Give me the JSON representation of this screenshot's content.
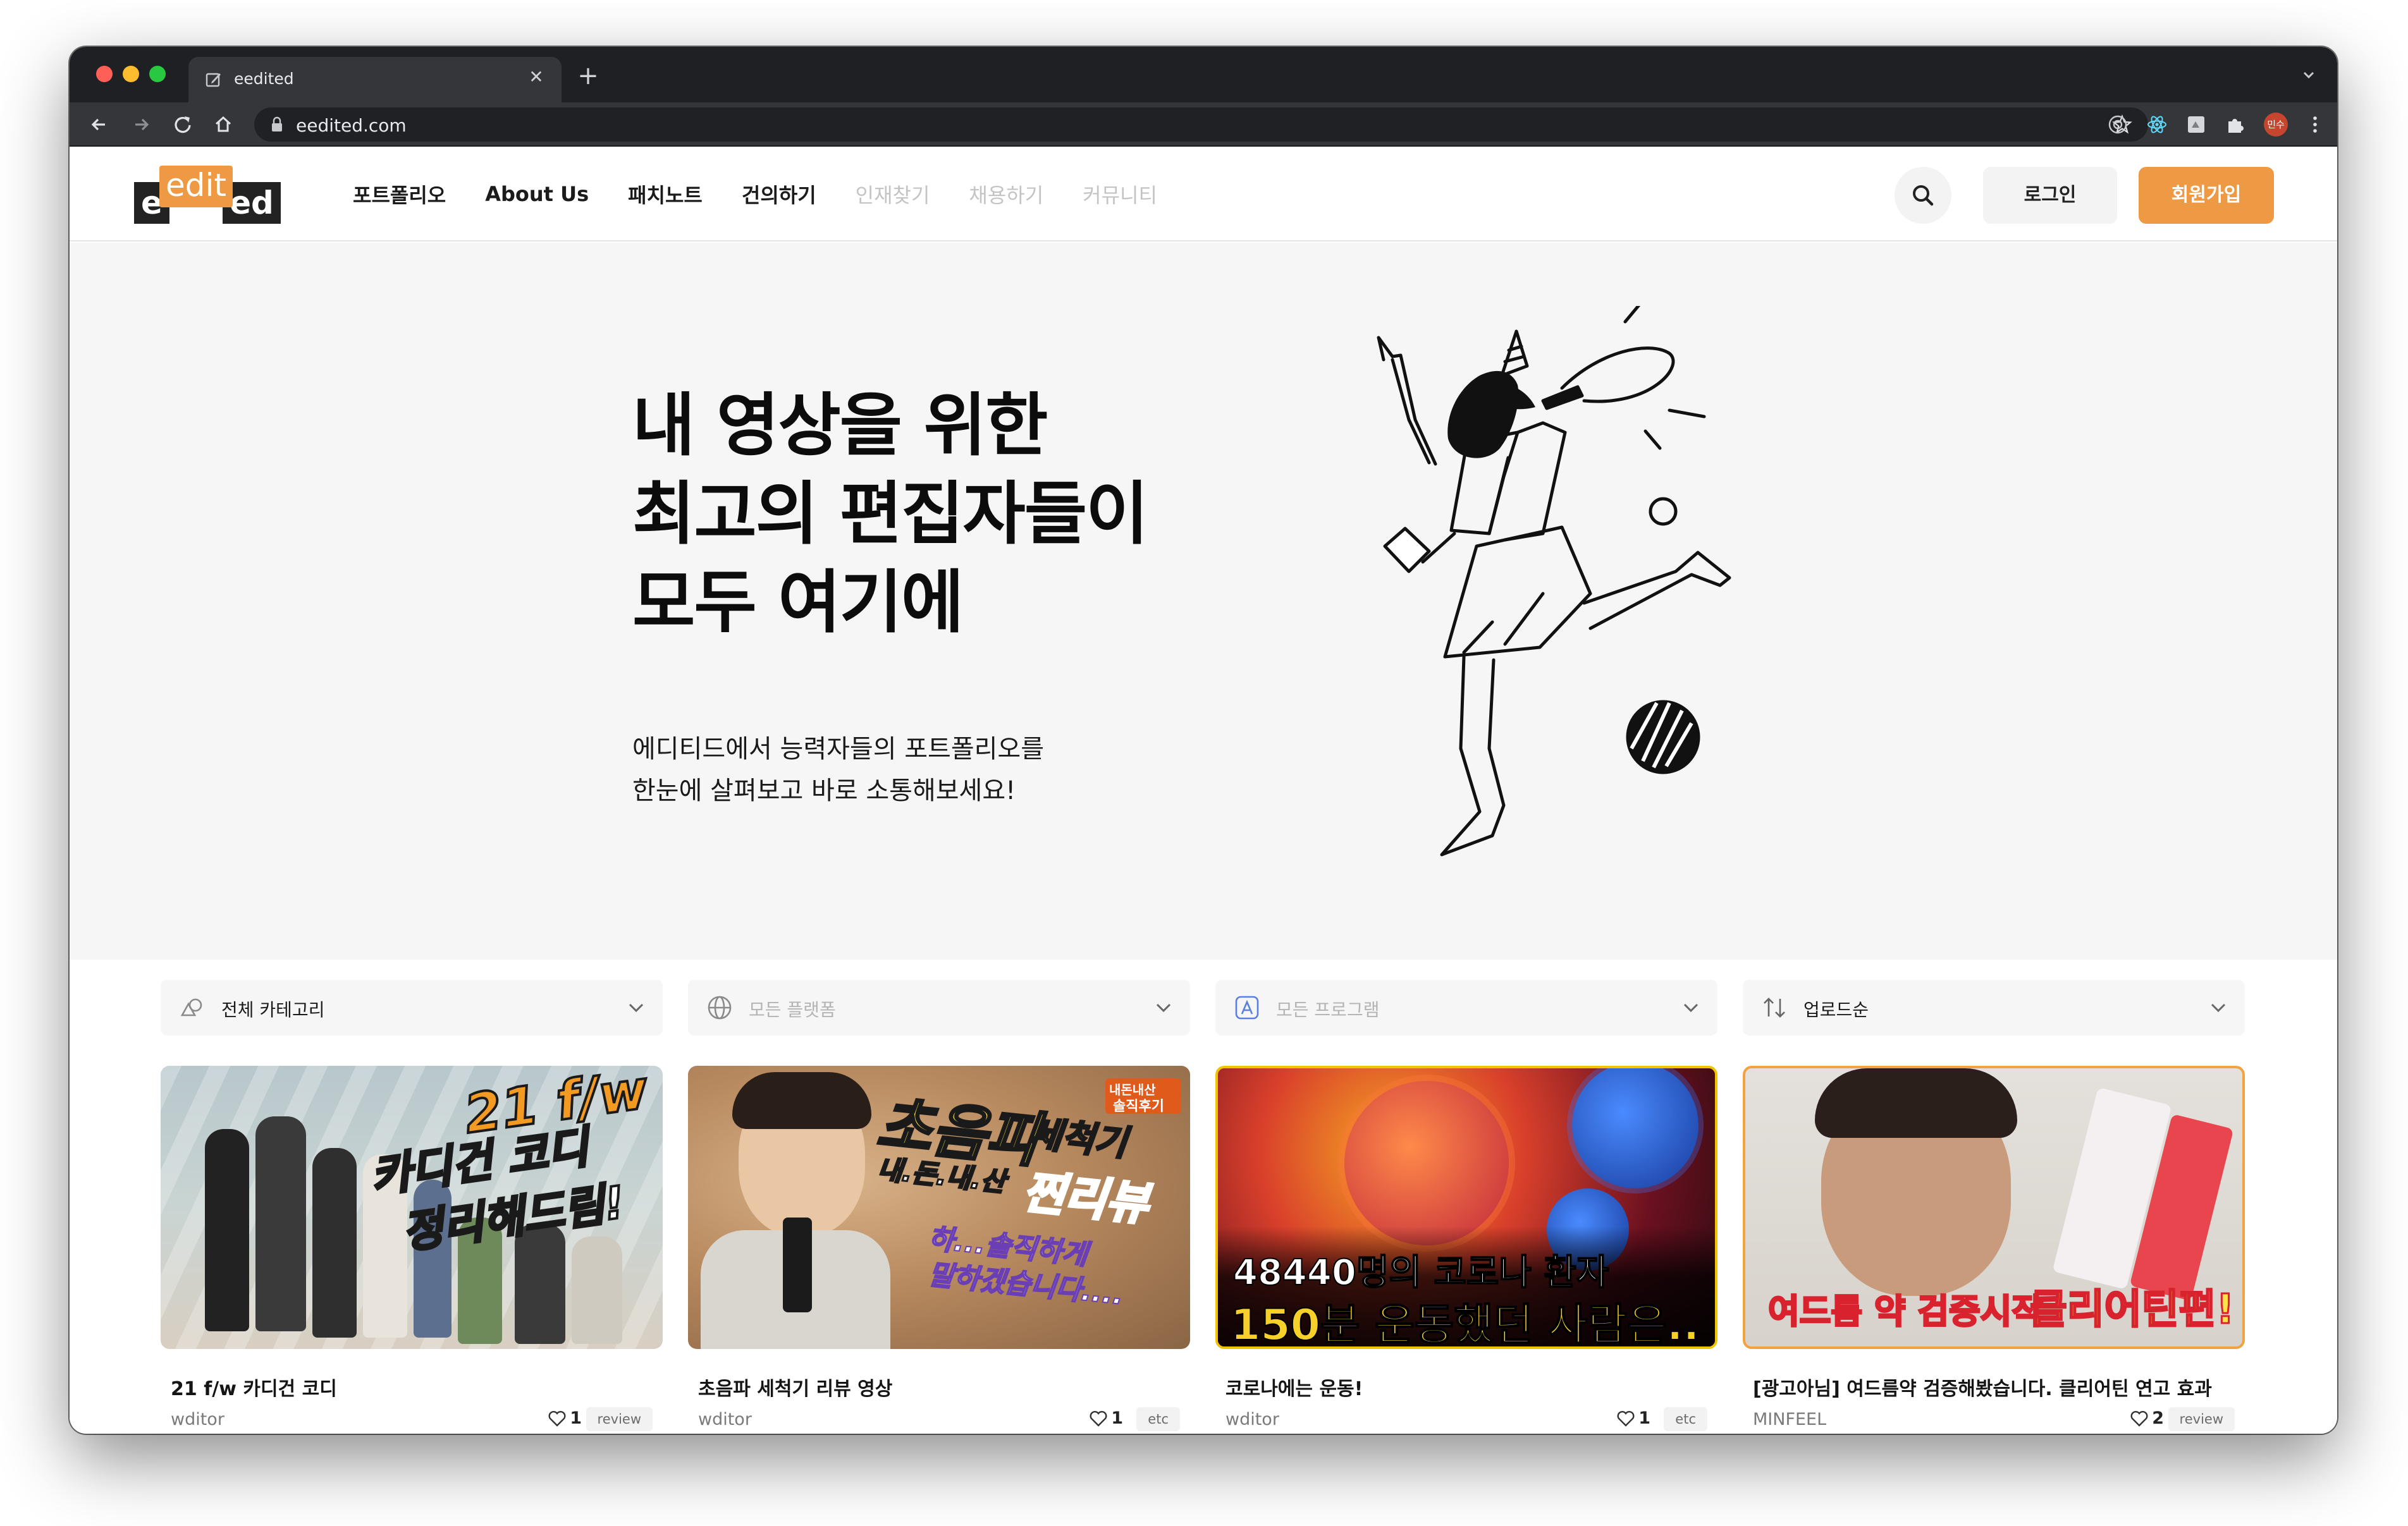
{
  "browser": {
    "tab_title": "eedited",
    "url": "eedited.com",
    "profile_initials": "민수"
  },
  "header": {
    "logo": {
      "left": "e",
      "middle": "edit",
      "right": "ed"
    },
    "nav": [
      "포트폴리오",
      "About Us",
      "패치노트",
      "건의하기",
      "인재찾기",
      "채용하기",
      "커뮤니티"
    ],
    "login_label": "로그인",
    "signup_label": "회원가입"
  },
  "hero": {
    "title_lines": [
      "내 영상을 위한",
      "최고의 편집자들이",
      "모두 여기에"
    ],
    "subtitle_lines": [
      "에디티드에서 능력자들의 포트폴리오를",
      "한눈에 살펴보고 바로 소통해보세요!"
    ]
  },
  "filters": [
    {
      "icon": "shapes-icon",
      "label": "전체 카테고리",
      "muted": false
    },
    {
      "icon": "globe-icon",
      "label": "모든 플랫폼",
      "muted": true
    },
    {
      "icon": "app-icon",
      "label": "모든 프로그램",
      "muted": true
    },
    {
      "icon": "sort-icon",
      "label": "업로드순",
      "muted": false
    }
  ],
  "cards": [
    {
      "title": "21 f/w 카디건 코디",
      "author": "wditor",
      "likes": "1",
      "tag": "review",
      "thumb_text": [
        "21 f/w",
        "카디건 코디",
        "정리해드림!"
      ]
    },
    {
      "title": "초음파 세척기 리뷰 영상",
      "author": "wditor",
      "likes": "1",
      "tag": "etc",
      "thumb_text": [
        "초음파",
        "세척기",
        "내.돈.내.산",
        "찐리뷰",
        "하...솔직하게",
        "말하겠습니다....",
        "내돈내산",
        "솔직후기"
      ]
    },
    {
      "title": "코로나에는 운동!",
      "author": "wditor",
      "likes": "1",
      "tag": "etc",
      "thumb_text": [
        "48440명의 코로나 환자",
        "150분 운동했던 사람은.."
      ]
    },
    {
      "title": "[광고아님] 여드름약 검증해봤습니다. 클리어틴 연고 효과",
      "author": "MINFEEL",
      "likes": "2",
      "tag": "review",
      "thumb_text": [
        "여드름 약 검증시작",
        "클리어틴편!"
      ]
    }
  ],
  "colors": {
    "accent": "#ee9a45",
    "hero_bg": "#f6f6f6",
    "text": "#151515",
    "muted": "#c4c4c4"
  }
}
